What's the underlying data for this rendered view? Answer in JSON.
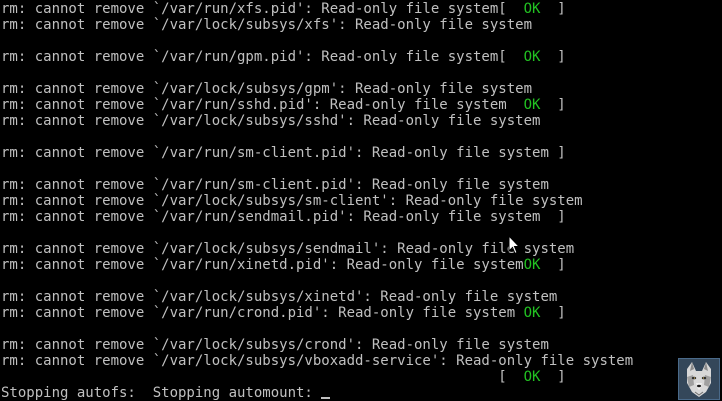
{
  "console": {
    "lines": [
      {
        "text": "rm: cannot remove `/var/run/xfs.pid': Read-only file system[  ",
        "ok": "OK",
        "tail": "  ]"
      },
      {
        "text": "rm: cannot remove `/var/lock/subsys/xfs': Read-only file system",
        "ok": "",
        "tail": ""
      },
      {
        "text": "",
        "ok": "",
        "tail": ""
      },
      {
        "text": "rm: cannot remove `/var/run/gpm.pid': Read-only file system[  ",
        "ok": "OK",
        "tail": "  ]"
      },
      {
        "text": "",
        "ok": "",
        "tail": ""
      },
      {
        "text": "rm: cannot remove `/var/lock/subsys/gpm': Read-only file system",
        "ok": "",
        "tail": ""
      },
      {
        "text": "rm: cannot remove `/var/run/sshd.pid': Read-only file system  ",
        "ok": "OK",
        "tail": "  ]"
      },
      {
        "text": "rm: cannot remove `/var/lock/subsys/sshd': Read-only file system",
        "ok": "",
        "tail": ""
      },
      {
        "text": "",
        "ok": "",
        "tail": ""
      },
      {
        "text": "rm: cannot remove `/var/run/sm-client.pid': Read-only file system ]",
        "ok": "",
        "tail": ""
      },
      {
        "text": "",
        "ok": "",
        "tail": ""
      },
      {
        "text": "rm: cannot remove `/var/run/sm-client.pid': Read-only file system",
        "ok": "",
        "tail": ""
      },
      {
        "text": "rm: cannot remove `/var/lock/subsys/sm-client': Read-only file system",
        "ok": "",
        "tail": ""
      },
      {
        "text": "rm: cannot remove `/var/run/sendmail.pid': Read-only file system  ]",
        "ok": "",
        "tail": ""
      },
      {
        "text": "",
        "ok": "",
        "tail": ""
      },
      {
        "text": "rm: cannot remove `/var/lock/subsys/sendmail': Read-only file system",
        "ok": "",
        "tail": ""
      },
      {
        "text": "rm: cannot remove `/var/run/xinetd.pid': Read-only file system",
        "ok": "OK",
        "tail": "  ]"
      },
      {
        "text": "",
        "ok": "",
        "tail": ""
      },
      {
        "text": "rm: cannot remove `/var/lock/subsys/xinetd': Read-only file system",
        "ok": "",
        "tail": ""
      },
      {
        "text": "rm: cannot remove `/var/run/crond.pid': Read-only file system ",
        "ok": "OK",
        "tail": "  ]"
      },
      {
        "text": "",
        "ok": "",
        "tail": ""
      },
      {
        "text": "rm: cannot remove `/var/lock/subsys/crond': Read-only file system",
        "ok": "",
        "tail": ""
      },
      {
        "text": "rm: cannot remove `/var/lock/subsys/vboxadd-service': Read-only file system",
        "ok": "",
        "tail": ""
      },
      {
        "text": "                                                           [  ",
        "ok": "OK",
        "tail": "  ]"
      },
      {
        "text": "Stopping autofs:  Stopping automount: ",
        "ok": "",
        "tail": ""
      }
    ]
  },
  "colors": {
    "background": "#000000",
    "text": "#c0c0c0",
    "ok": "#22c222"
  },
  "icons": {
    "pointer": "mouse-pointer-icon",
    "tile": "wolf-icon"
  }
}
